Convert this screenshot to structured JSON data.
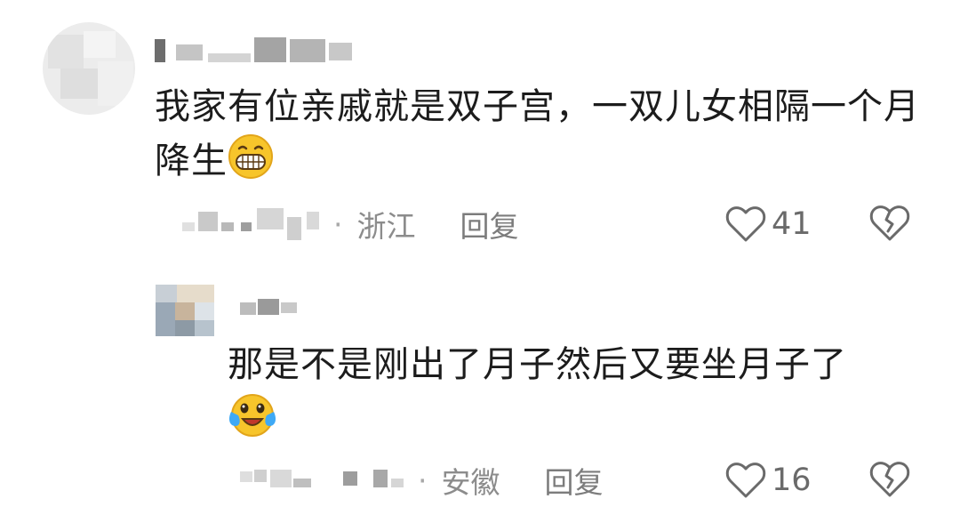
{
  "comments": [
    {
      "text": "我家有位亲戚就是双子宫，一双儿女相隔一个月降生",
      "location": "浙江",
      "reply_label": "回复",
      "like_count": "41",
      "emoji": "grinning-face-emoji"
    }
  ],
  "replies": [
    {
      "text": "那是不是刚出了月子然后又要坐月子了",
      "location": "安徽",
      "reply_label": "回复",
      "like_count": "16",
      "emoji": "laughing-crying-face-emoji"
    }
  ],
  "icons": {
    "like": "heart-outline-icon",
    "dislike": "broken-heart-icon"
  },
  "colors": {
    "text_primary": "#1c1c1c",
    "text_secondary": "#8c8c8c",
    "icon_gray": "#6a6a6a",
    "emoji_yellow": "#f7c52b"
  }
}
